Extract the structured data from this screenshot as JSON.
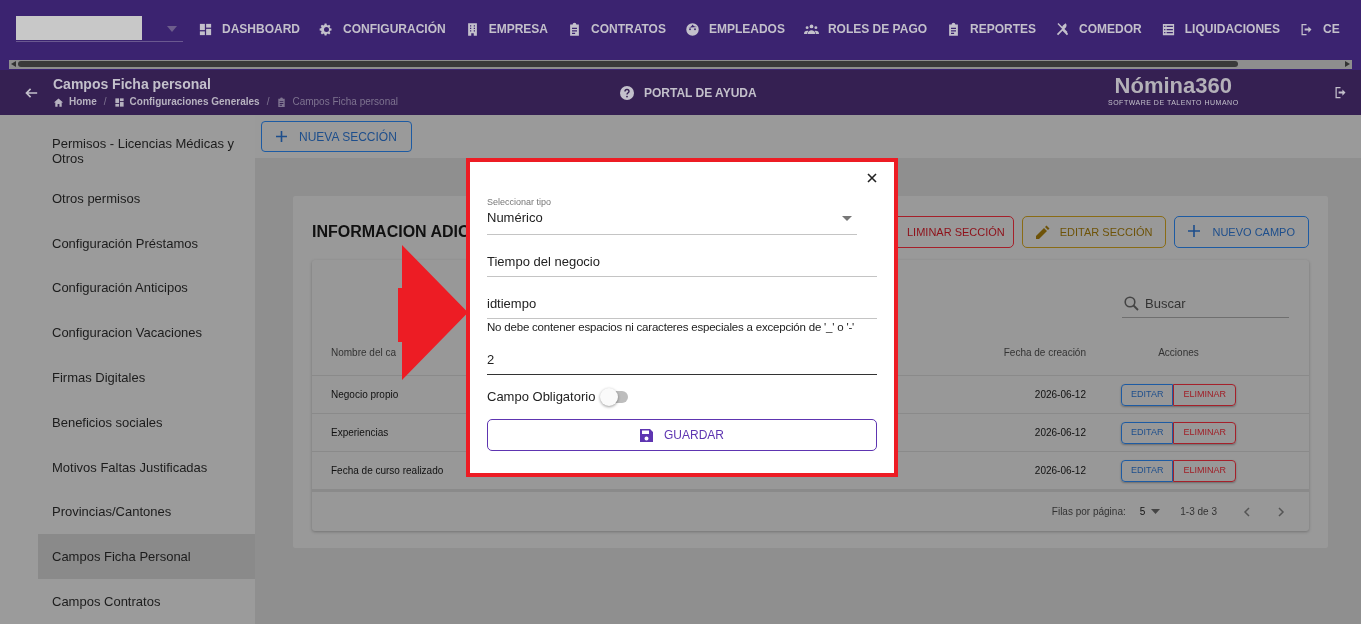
{
  "top_nav": {
    "items": [
      {
        "label": "DASHBOARD"
      },
      {
        "label": "CONFIGURACIÓN"
      },
      {
        "label": "EMPRESA"
      },
      {
        "label": "CONTRATOS"
      },
      {
        "label": "EMPLEADOS"
      },
      {
        "label": "ROLES DE PAGO"
      },
      {
        "label": "REPORTES"
      },
      {
        "label": "COMEDOR"
      },
      {
        "label": "LIQUIDACIONES"
      },
      {
        "label": "CE"
      }
    ]
  },
  "header": {
    "title": "Campos Ficha personal",
    "breadcrumbs": [
      {
        "label": "Home"
      },
      {
        "label": "Configuraciones Generales"
      },
      {
        "label": "Campos Ficha personal"
      }
    ],
    "breadcrumb_separators": [
      "/",
      "/"
    ],
    "help_link": "PORTAL DE AYUDA",
    "logo": {
      "name": "Nómina360",
      "tagline": "SOFTWARE DE TALENTO HUMANO"
    }
  },
  "sidebar": {
    "items": [
      {
        "label": "Permisos - Licencias Médicas y Otros",
        "selected": false
      },
      {
        "label": "Otros permisos",
        "selected": false
      },
      {
        "label": "Configuración Préstamos",
        "selected": false
      },
      {
        "label": "Configuración Anticipos",
        "selected": false
      },
      {
        "label": "Configuracion Vacaciones",
        "selected": false
      },
      {
        "label": "Firmas Digitales",
        "selected": false
      },
      {
        "label": "Beneficios sociales",
        "selected": false
      },
      {
        "label": "Motivos Faltas Justificadas",
        "selected": false
      },
      {
        "label": "Provincias/Cantones",
        "selected": false
      },
      {
        "label": "Campos Ficha Personal",
        "selected": true
      },
      {
        "label": "Campos Contratos",
        "selected": false
      }
    ]
  },
  "new_section_button": "NUEVA SECCIÓN",
  "section": {
    "title": "INFORMACION ADIC",
    "buttons": [
      {
        "label": "LIMINAR SECCIÓN",
        "kind": "delete"
      },
      {
        "label": "EDITAR SECCIÓN",
        "kind": "edit"
      },
      {
        "label": "NUEVO CAMPO",
        "kind": "add"
      }
    ],
    "table": {
      "search_placeholder": "Buscar",
      "columns": [
        "Nombre del ca",
        "Fecha de creación",
        "Acciones"
      ],
      "rows": [
        {
          "name": "Negocio propio",
          "date": "2026-06-12",
          "actions": [
            "EDITAR",
            "ELIMINAR"
          ]
        },
        {
          "name": "Experiencias",
          "date": "2026-06-12",
          "actions": [
            "EDITAR",
            "ELIMINAR"
          ]
        },
        {
          "name": "Fecha de curso realizado",
          "date": "2026-06-12",
          "actions": [
            "EDITAR",
            "ELIMINAR"
          ]
        }
      ],
      "pagination": {
        "rows_per_page_label": "Filas por página:",
        "rows_per_page": "5",
        "range": "1-3 de 3"
      }
    }
  },
  "dialog": {
    "type_select": {
      "label": "Seleccionar tipo",
      "value": "Numérico"
    },
    "name_field": {
      "value": "Tiempo del negocio"
    },
    "key_field": {
      "value": "idtiempo",
      "helper": "No debe contener espacios ni caracteres especiales a excepción de '_' o '-'"
    },
    "number_field": {
      "value": "2"
    },
    "required_toggle": {
      "label": "Campo Obligatorio",
      "on": false
    },
    "save_button": "GUARDAR"
  }
}
